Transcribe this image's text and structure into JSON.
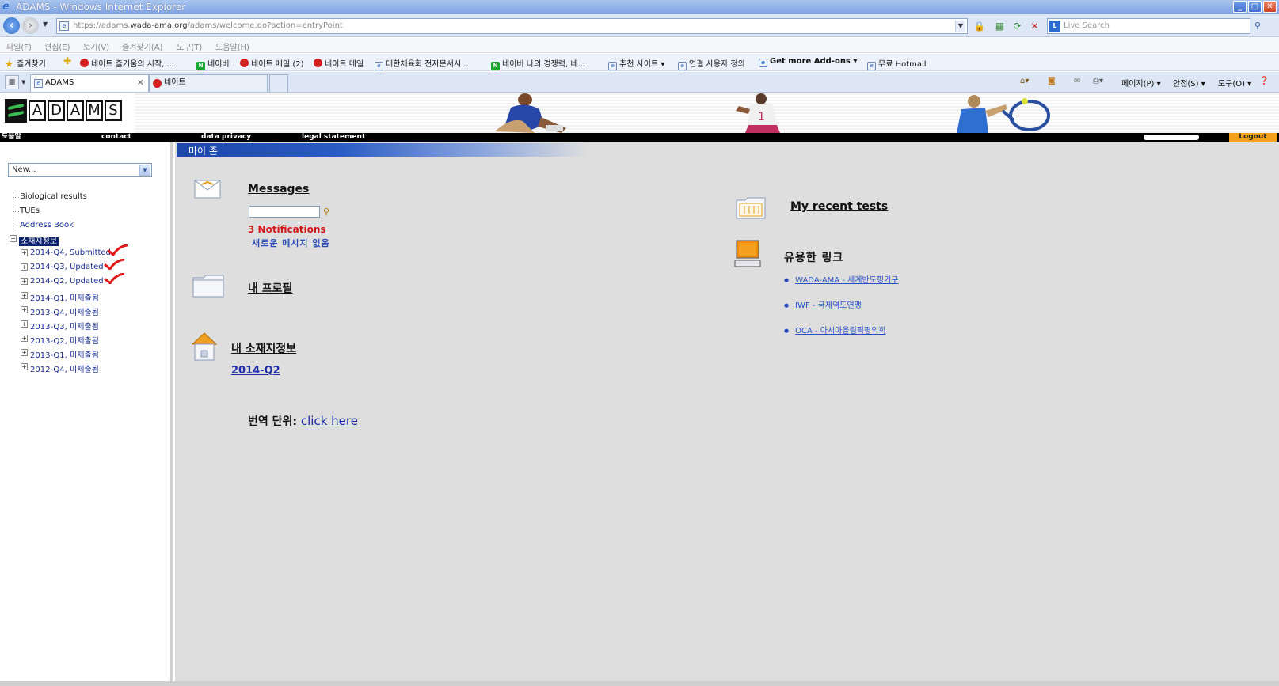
{
  "window": {
    "title": "ADAMS - Windows Internet Explorer",
    "buttons": {
      "minimize": "_",
      "maximize": "□",
      "close": "✕"
    }
  },
  "addressbar": {
    "url_prefix": "https://adams.",
    "url_host": "wada-ama.org",
    "url_path": "/adams/welcome.do?action=entryPoint",
    "search_placeholder": "Live Search"
  },
  "menubar": [
    "파일(F)",
    "편집(E)",
    "보기(V)",
    "즐겨찾기(A)",
    "도구(T)",
    "도움말(H)"
  ],
  "favorites": {
    "label": "즐겨찾기",
    "items": [
      {
        "label": "네이트 즐거움의 시작, ...",
        "icon": "red"
      },
      {
        "label": "네이버",
        "icon": "green"
      },
      {
        "label": "네이트 메일 (2)",
        "icon": "red"
      },
      {
        "label": "네이트 메일",
        "icon": "red"
      },
      {
        "label": "대한체육회 전자문서시...",
        "icon": "ie"
      },
      {
        "label": "네이버 나의 경쟁력, 네...",
        "icon": "green"
      },
      {
        "label": "추천 사이트 ▾",
        "icon": "ie"
      },
      {
        "label": "연결 사용자 정의",
        "icon": "ie"
      },
      {
        "label": "Get more Add-ons ▾",
        "icon": "ie"
      },
      {
        "label": "무료 Hotmail",
        "icon": "ie"
      }
    ]
  },
  "tabs": [
    {
      "label": "ADAMS",
      "active": true
    },
    {
      "label": "네이트",
      "active": false
    }
  ],
  "commandbar": {
    "page": "페이지(P) ▾",
    "safety": "안전(S) ▾",
    "tools": "도구(O) ▾"
  },
  "site": {
    "logo_letters": [
      "A",
      "D",
      "A",
      "M",
      "S"
    ],
    "nav": {
      "help": "도움말",
      "contact": "contact",
      "privacy": "data privacy",
      "legal": "legal statement",
      "logout": "Logout"
    }
  },
  "sidebar": {
    "select_value": "New...",
    "items": [
      {
        "label": "Biological results"
      },
      {
        "label": "TUEs"
      },
      {
        "label": "Address Book"
      }
    ],
    "whereabouts_label": "소재지정보",
    "quarters": [
      {
        "label": "2014-Q4, Submitted",
        "checked": true
      },
      {
        "label": "2014-Q3, Updated",
        "checked": true
      },
      {
        "label": "2014-Q2, Updated",
        "checked": true
      },
      {
        "label": "2014-Q1, 미제출됨",
        "checked": false
      },
      {
        "label": "2013-Q4, 미제출됨",
        "checked": false
      },
      {
        "label": "2013-Q3, 미제출됨",
        "checked": false
      },
      {
        "label": "2013-Q2, 미제출됨",
        "checked": false
      },
      {
        "label": "2013-Q1, 미제출됨",
        "checked": false
      },
      {
        "label": "2012-Q4, 미제출됨",
        "checked": false
      }
    ]
  },
  "main": {
    "zone_title": "마이 존",
    "messages": {
      "title": "Messages",
      "notifications": "3 Notifications",
      "no_new": "새로운 메시지 없음"
    },
    "profile": {
      "title": "내 프로필"
    },
    "whereabouts": {
      "title": "내 소재지정보",
      "quarter": "2014-Q2"
    },
    "translate": {
      "label": "번역 단위:",
      "link": "click here"
    },
    "recent_tests": {
      "title": "My recent tests"
    },
    "useful_links": {
      "title": "유용한 링크",
      "links": [
        "WADA-AMA - 세계반도핑기구",
        "IWF - 국제역도연맹",
        "OCA - 아시아올림픽평의회"
      ]
    }
  },
  "colors": {
    "ie_titlebar": "#7fa4e4",
    "zone_bar": "#1e47a8",
    "notification_red": "#d01c1c",
    "link_blue": "#1f2ea8",
    "logout_orange": "#f4a21b",
    "check_red": "#e01818"
  }
}
